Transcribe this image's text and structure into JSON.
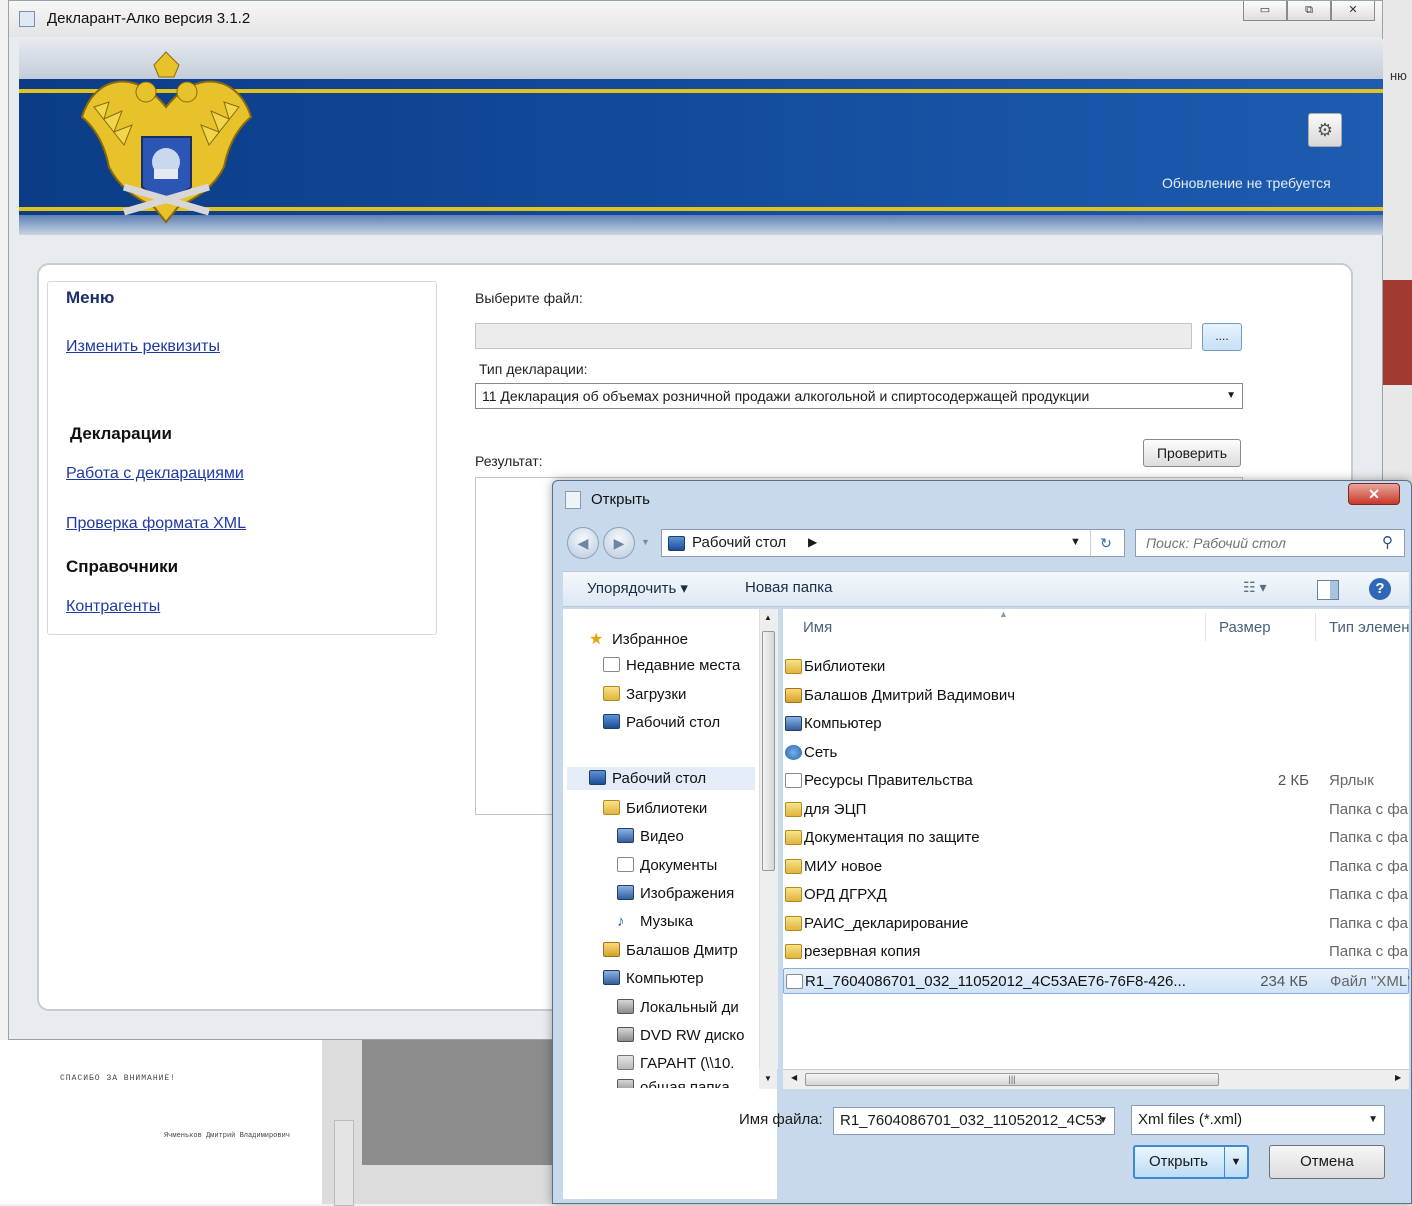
{
  "app": {
    "title": "Декларант-Алко версия 3.1.2",
    "update_status": "Обновление не требуется",
    "window_controls": [
      "▭",
      "⧉",
      "✕"
    ]
  },
  "menu": {
    "title": "Меню",
    "edit_details": "Изменить реквизиты",
    "declarations_heading": "Декларации",
    "work_with_declarations": "Работа с декларациями",
    "xml_check": "Проверка формата XML",
    "references_heading": "Справочники",
    "contractors": "Контрагенты"
  },
  "form": {
    "choose_file_label": "Выберите файл:",
    "file_path_value": "",
    "browse_label": "....",
    "declaration_type_label": "Тип декларации:",
    "declaration_type_value": "11 Декларация об объемах розничной продажи алкогольной и спиртосодержащей продукции",
    "check_button": "Проверить",
    "result_label": "Результат:"
  },
  "dialog": {
    "title": "Открыть",
    "close_label": "✕",
    "address": "Рабочий стол",
    "search_placeholder": "Поиск: Рабочий стол",
    "toolbar": {
      "organize": "Упорядочить ▾",
      "new_folder": "Новая папка"
    },
    "columns": {
      "name": "Имя",
      "size": "Размер",
      "type": "Тип элемента"
    },
    "nav": [
      {
        "label": "Избранное",
        "icon": "star-icon"
      },
      {
        "label": "Недавние места",
        "icon": "recent-places-icon"
      },
      {
        "label": "Загрузки",
        "icon": "downloads-icon"
      },
      {
        "label": "Рабочий стол",
        "icon": "desktop-icon"
      },
      {
        "label": "Рабочий стол",
        "icon": "desktop-icon"
      },
      {
        "label": "Библиотеки",
        "icon": "libraries-icon"
      },
      {
        "label": "Видео",
        "icon": "video-icon"
      },
      {
        "label": "Документы",
        "icon": "documents-icon"
      },
      {
        "label": "Изображения",
        "icon": "images-icon"
      },
      {
        "label": "Музыка",
        "icon": "music-icon"
      },
      {
        "label": "Балашов Дмитр",
        "icon": "user-folder-icon"
      },
      {
        "label": "Компьютер",
        "icon": "computer-icon"
      },
      {
        "label": "Локальный ди",
        "icon": "local-disk-icon"
      },
      {
        "label": "DVD RW диско",
        "icon": "dvd-drive-icon"
      },
      {
        "label": "ГАРАНТ (\\\\10.",
        "icon": "network-drive-icon"
      },
      {
        "label": "общая папка",
        "icon": "network-drive-icon"
      }
    ],
    "files": [
      {
        "name": "Библиотеки",
        "size": "",
        "type": "",
        "icon": "libraries-icon"
      },
      {
        "name": "Балашов Дмитрий Вадимович",
        "size": "",
        "type": "",
        "icon": "user-folder-icon"
      },
      {
        "name": "Компьютер",
        "size": "",
        "type": "",
        "icon": "computer-icon"
      },
      {
        "name": "Сеть",
        "size": "",
        "type": "",
        "icon": "network-icon"
      },
      {
        "name": "Ресурсы Правительства",
        "size": "2 КБ",
        "type": "Ярлык",
        "icon": "shortcut-icon"
      },
      {
        "name": "для ЭЦП",
        "size": "",
        "type": "Папка с файлами",
        "icon": "folder-icon"
      },
      {
        "name": "Документация по защите",
        "size": "",
        "type": "Папка с файлами",
        "icon": "folder-icon"
      },
      {
        "name": "МИУ новое",
        "size": "",
        "type": "Папка с файлами",
        "icon": "folder-icon"
      },
      {
        "name": "ОРД ДГРХД",
        "size": "",
        "type": "Папка с файлами",
        "icon": "folder-icon"
      },
      {
        "name": "РАИС_декларирование",
        "size": "",
        "type": "Папка с файлами",
        "icon": "folder-icon"
      },
      {
        "name": "резервная копия",
        "size": "",
        "type": "Папка с файлами",
        "icon": "folder-icon"
      },
      {
        "name": "R1_7604086701_032_11052012_4C53AE76-76F8-426...",
        "size": "234 КБ",
        "type": "Файл \"XML\"",
        "icon": "xml-file-icon"
      }
    ],
    "filename_label": "Имя файла:",
    "filename_value": "R1_7604086701_032_11052012_4C53",
    "filetype_value": "Xml files (*.xml)",
    "open_button": "Открыть",
    "cancel_button": "Отмена"
  },
  "background": {
    "right_edge_text": "ню",
    "slide_thanks": "СПАСИБО ЗА ВНИМАНИЕ!",
    "slide_author": "Ячменьков Дмитрий Владимирович"
  }
}
